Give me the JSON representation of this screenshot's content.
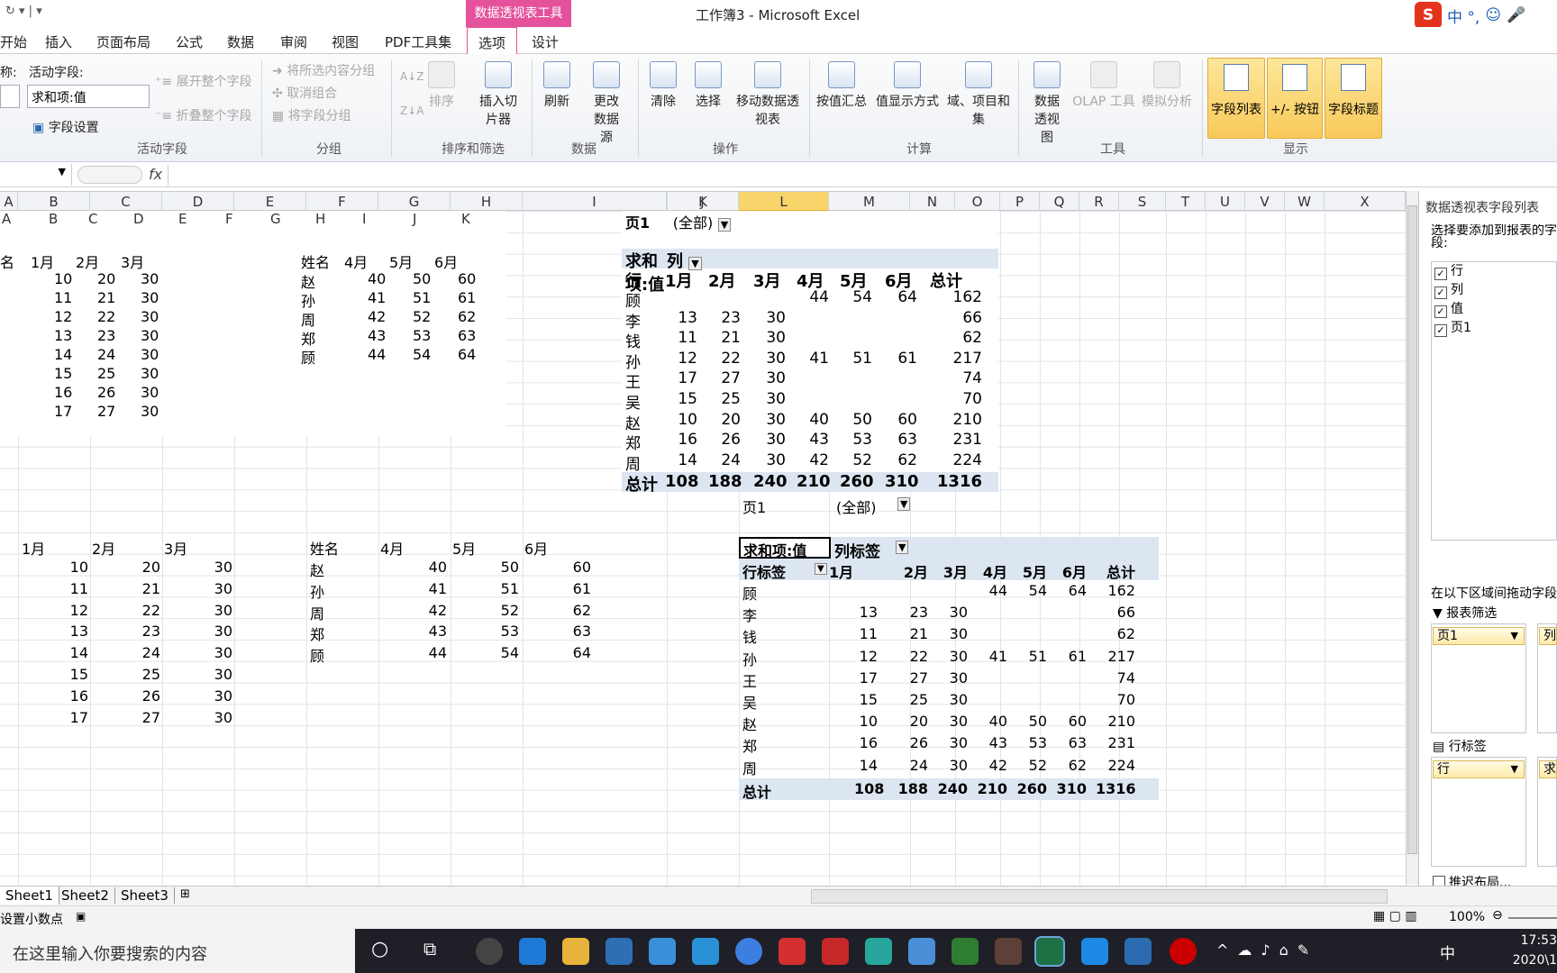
{
  "window": {
    "title": "工作簿3 - Microsoft Excel",
    "context_tab": "数据透视表工具",
    "qat": "↻ ▾ | ▾"
  },
  "ime": {
    "logo": "S",
    "label": "中 °,"
  },
  "tabs": [
    "开始",
    "插入",
    "页面布局",
    "公式",
    "数据",
    "审阅",
    "视图",
    "PDF工具集",
    "选项",
    "设计"
  ],
  "ribbon": {
    "name_label": "称:",
    "active_field_label": "活动字段:",
    "active_field_value": "求和项:值",
    "field_settings": "字段设置",
    "expand": "展开整个字段",
    "collapse": "折叠整个字段",
    "group_sel": "将所选内容分组",
    "ungroup": "取消组合",
    "group_field": "将字段分组",
    "sort": "排序",
    "insert_slicer": "插入切片器",
    "refresh": "刷新",
    "change_source": "更改数据源",
    "clear": "清除",
    "select": "选择",
    "move": "移动数据透视表",
    "summarize": "按值汇总",
    "show_as": "值显示方式",
    "fields_items": "域、项目和集",
    "pivotchart": "数据透视图",
    "olap": "OLAP 工具",
    "whatif": "模拟分析",
    "field_list": "字段列表",
    "buttons": "+/- 按钮",
    "headers": "字段标题",
    "groups": [
      "活动字段",
      "分组",
      "排序和筛选",
      "数据",
      "操作",
      "计算",
      "工具",
      "显示"
    ]
  },
  "formula": {
    "fx": "fx"
  },
  "columns": [
    "A",
    "B",
    "C",
    "D",
    "E",
    "F",
    "G",
    "H",
    "I",
    "J",
    "K",
    "L",
    "M",
    "N",
    "O",
    "P",
    "Q",
    "R",
    "S",
    "T",
    "U",
    "V",
    "W",
    "X"
  ],
  "top_left": {
    "header": [
      "名",
      "1月",
      "2月",
      "3月"
    ],
    "rows": [
      [
        "10",
        "20",
        "30"
      ],
      [
        "11",
        "21",
        "30"
      ],
      [
        "12",
        "22",
        "30"
      ],
      [
        "13",
        "23",
        "30"
      ],
      [
        "14",
        "24",
        "30"
      ],
      [
        "15",
        "25",
        "30"
      ],
      [
        "16",
        "26",
        "30"
      ],
      [
        "17",
        "27",
        "30"
      ]
    ],
    "sub_cols": [
      "A",
      "B",
      "C",
      "D",
      "E",
      "F",
      "G",
      "H",
      "I",
      "J",
      "K"
    ]
  },
  "top_right": {
    "header": [
      "姓名",
      "4月",
      "5月",
      "6月"
    ],
    "rows": [
      [
        "赵",
        "40",
        "50",
        "60"
      ],
      [
        "孙",
        "41",
        "51",
        "61"
      ],
      [
        "周",
        "42",
        "52",
        "62"
      ],
      [
        "郑",
        "43",
        "53",
        "63"
      ],
      [
        "顾",
        "44",
        "54",
        "64"
      ]
    ]
  },
  "pivot1": {
    "page_label": "页1",
    "page_value": "(全部)",
    "sum_label": "求和项:值",
    "col_label": "列",
    "row_label": "行",
    "headers": [
      "1月",
      "2月",
      "3月",
      "4月",
      "5月",
      "6月",
      "总计"
    ],
    "rows": [
      [
        "顾",
        "",
        "",
        "",
        "44",
        "54",
        "64",
        "162"
      ],
      [
        "李",
        "13",
        "23",
        "30",
        "",
        "",
        "",
        "66"
      ],
      [
        "钱",
        "11",
        "21",
        "30",
        "",
        "",
        "",
        "62"
      ],
      [
        "孙",
        "12",
        "22",
        "30",
        "41",
        "51",
        "61",
        "217"
      ],
      [
        "王",
        "17",
        "27",
        "30",
        "",
        "",
        "",
        "74"
      ],
      [
        "吴",
        "15",
        "25",
        "30",
        "",
        "",
        "",
        "70"
      ],
      [
        "赵",
        "10",
        "20",
        "30",
        "40",
        "50",
        "60",
        "210"
      ],
      [
        "郑",
        "16",
        "26",
        "30",
        "43",
        "53",
        "63",
        "231"
      ],
      [
        "周",
        "14",
        "24",
        "30",
        "42",
        "52",
        "62",
        "224"
      ]
    ],
    "total": [
      "总计",
      "108",
      "188",
      "240",
      "210",
      "260",
      "310",
      "1316"
    ]
  },
  "bottom_left": {
    "header": [
      "1月",
      "2月",
      "3月"
    ],
    "rows": [
      [
        "10",
        "20",
        "30"
      ],
      [
        "11",
        "21",
        "30"
      ],
      [
        "12",
        "22",
        "30"
      ],
      [
        "13",
        "23",
        "30"
      ],
      [
        "14",
        "24",
        "30"
      ],
      [
        "15",
        "25",
        "30"
      ],
      [
        "16",
        "26",
        "30"
      ],
      [
        "17",
        "27",
        "30"
      ]
    ]
  },
  "bottom_mid": {
    "header": [
      "姓名",
      "4月",
      "5月",
      "6月"
    ],
    "rows": [
      [
        "赵",
        "40",
        "50",
        "60"
      ],
      [
        "孙",
        "41",
        "51",
        "61"
      ],
      [
        "周",
        "42",
        "52",
        "62"
      ],
      [
        "郑",
        "43",
        "53",
        "63"
      ],
      [
        "顾",
        "44",
        "54",
        "64"
      ]
    ]
  },
  "pivot2": {
    "page_label": "页1",
    "page_value": "(全部)",
    "sum_label": "求和项:值",
    "col_label": "列标签",
    "row_label": "行标签",
    "headers": [
      "1月",
      "2月",
      "3月",
      "4月",
      "5月",
      "6月",
      "总计"
    ]
  },
  "panel": {
    "title": "数据透视表字段列表",
    "prompt": "选择要添加到报表的字段:",
    "fields": [
      "行",
      "列",
      "值",
      "页1"
    ],
    "drag_hint": "在以下区域间拖动字段",
    "filter_zone": "报表筛选",
    "filter_pill": "页1",
    "row_zone": "行标签",
    "row_pill": "行",
    "col_zone_pill": "列",
    "val_zone_pill": "求",
    "defer": "推迟布局..."
  },
  "sheets": [
    "Sheet1",
    "Sheet2",
    "Sheet3"
  ],
  "status": {
    "left": "设置小数点",
    "zoom": "100%"
  },
  "taskbar": {
    "search": "在这里输入你要搜索的内容",
    "time": "17:53",
    "date": "2020\\1",
    "ime": "中"
  }
}
